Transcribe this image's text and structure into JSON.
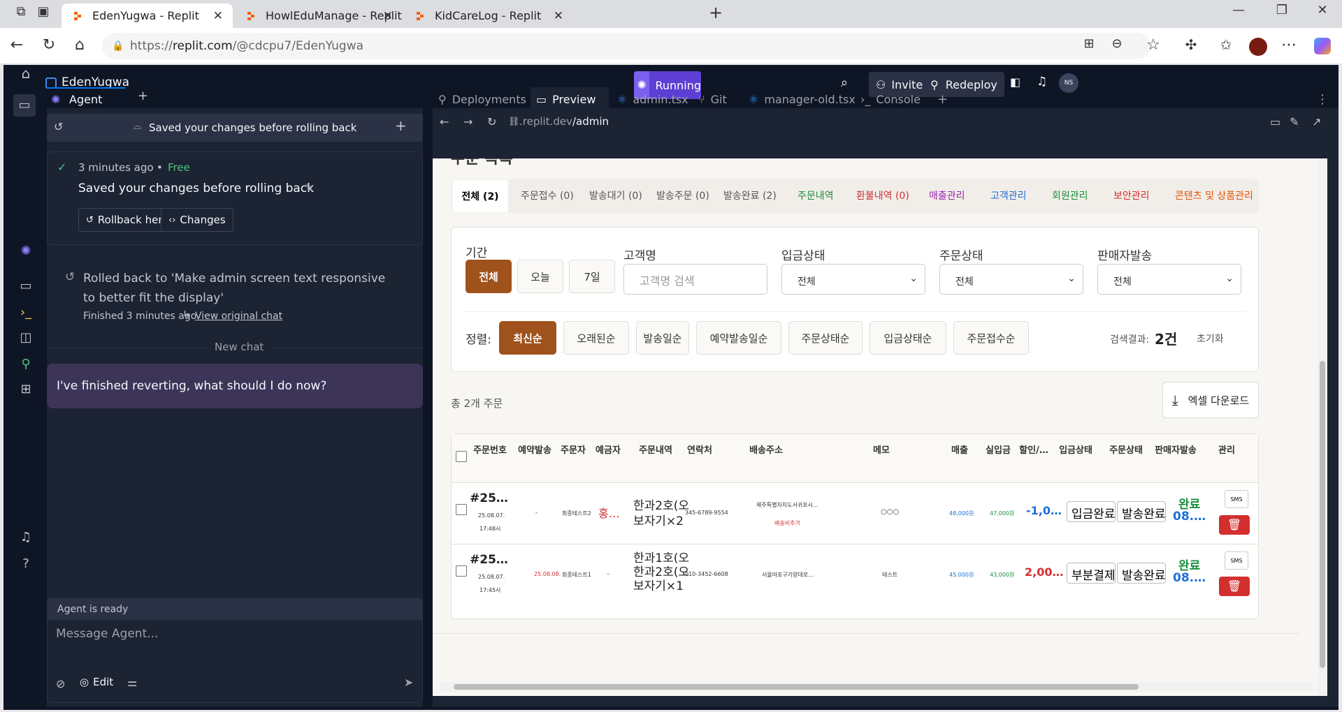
{
  "browser": {
    "tabs": [
      {
        "title": "EdenYugwa - Replit"
      },
      {
        "title": "HowlEduManage - Replit"
      },
      {
        "title": "KidCareLog - Replit"
      }
    ],
    "url_prefix": "https://",
    "url_host": "replit.com",
    "url_path": "/@cdcpu7/EdenYugwa"
  },
  "app": {
    "project": "EdenYugwa",
    "status": "Running",
    "invite": "Invite",
    "redeploy": "Redeploy",
    "avatar": "NS"
  },
  "agent": {
    "tab": "Agent",
    "history_title": "Saved your changes before rolling back",
    "checkpoint_time": "3 minutes ago",
    "checkpoint_price": "Free",
    "checkpoint_title": "Saved your changes before rolling back",
    "rollback_btn": "Rollback here",
    "changes_btn": "Changes",
    "rolled_back": "Rolled back to 'Make admin screen text responsive to better fit the display'",
    "finished": "Finished 3 minutes ago",
    "view_chat": "View original chat",
    "new_chat": "New chat",
    "message": "I've finished reverting, what should I do now?",
    "ready": "Agent is ready",
    "placeholder": "Message Agent...",
    "edit": "Edit"
  },
  "panes": {
    "tabs": [
      "Deployments",
      "Preview",
      "admin.tsx",
      "Git",
      "manager-old.tsx",
      "Console"
    ],
    "preview_url_prefix": ".replit.dev",
    "preview_url_path": "/admin"
  },
  "admin": {
    "heading": "주문 목록",
    "tabs": [
      {
        "label": "전체 (2)",
        "color": "#222"
      },
      {
        "label": "주문접수 (0)",
        "color": "#555"
      },
      {
        "label": "발송대기 (0)",
        "color": "#555"
      },
      {
        "label": "발송주문 (0)",
        "color": "#555"
      },
      {
        "label": "발송완료 (2)",
        "color": "#555"
      },
      {
        "label": "주문내역",
        "color": "#1a8f3c"
      },
      {
        "label": "환불내역 (0)",
        "color": "#d32f2f"
      },
      {
        "label": "매출관리",
        "color": "#9c27b0"
      },
      {
        "label": "고객관리",
        "color": "#1e6fd9"
      },
      {
        "label": "회원관리",
        "color": "#1a8f3c"
      },
      {
        "label": "보안관리",
        "color": "#d32f2f"
      },
      {
        "label": "콘텐츠 및 상품관리",
        "color": "#e65100"
      }
    ],
    "filter": {
      "period_label": "기간",
      "period_all": "전체",
      "period_today": "오늘",
      "period_7d": "7일",
      "customer_label": "고객명",
      "customer_placeholder": "고객명 검색",
      "payment_label": "입금상태",
      "payment_value": "전체",
      "order_label": "주문상태",
      "order_value": "전체",
      "seller_label": "판매자발송",
      "seller_value": "전체",
      "sort_label": "정렬:",
      "sorts": [
        "최신순",
        "오래된순",
        "발송일순",
        "예약발송일순",
        "주문상태순",
        "입금상태순",
        "주문접수순"
      ],
      "result_label": "검색결과:",
      "result_count": "2건",
      "reset": "초기화"
    },
    "total": "총 2개 주문",
    "excel": "엑셀 다운로드",
    "columns": [
      "주문번호",
      "예약발송",
      "주문자",
      "예금자",
      "주문내역",
      "연락처",
      "배송주소",
      "메모",
      "매출",
      "실입금",
      "할인/…",
      "입금상태",
      "주문상태",
      "판매자발송",
      "관리"
    ],
    "rows": [
      {
        "no": "#25…",
        "date": "25.08.07.",
        "time": "17:48시",
        "reserve": "-",
        "orderer": "최종테스트2",
        "depositor": "홍…",
        "items": [
          "한과2호(오",
          "보자기×2"
        ],
        "phone": "345-6789-9554",
        "address": "제주특별자치도서귀포시…",
        "addr_note": "배송비추가",
        "memo": "○○○",
        "sales": "48,000원",
        "paid": "47,000원",
        "discount": "-1,0…",
        "discount_color": "#1e6fd9",
        "pay": "입금완료",
        "status": "발송완료",
        "seller": "완료",
        "seller_date": "08.…",
        "sms": "SMS"
      },
      {
        "no": "#25…",
        "date": "25.08.07.",
        "time": "17:45시",
        "reserve": "25.08.08.",
        "orderer": "최종테스트1",
        "depositor": "–",
        "items": [
          "한과1호(오",
          "한과2호(오",
          "보자기×1"
        ],
        "phone": "010-3452-6608",
        "address": "서울마포구기양대로…",
        "addr_note": "",
        "memo": "테스트",
        "sales": "45,000원",
        "paid": "43,000원",
        "discount": "2,00…",
        "discount_color": "#d32f2f",
        "pay": "부분결제",
        "status": "발송완료",
        "seller": "완료",
        "seller_date": "08.…",
        "sms": "SMS"
      }
    ]
  }
}
